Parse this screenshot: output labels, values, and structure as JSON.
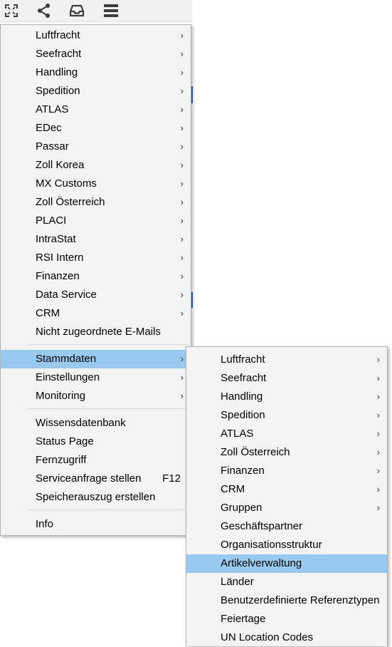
{
  "toolbar": {
    "icons": [
      "expand-icon",
      "share-icon",
      "inbox-icon",
      "hamburger-icon"
    ]
  },
  "main_menu": {
    "group1": [
      {
        "label": "Luftfracht",
        "submenu": true
      },
      {
        "label": "Seefracht",
        "submenu": true
      },
      {
        "label": "Handling",
        "submenu": true
      },
      {
        "label": "Spedition",
        "submenu": true
      },
      {
        "label": "ATLAS",
        "submenu": true
      },
      {
        "label": "EDec",
        "submenu": true
      },
      {
        "label": "Passar",
        "submenu": true
      },
      {
        "label": "Zoll Korea",
        "submenu": true
      },
      {
        "label": "MX Customs",
        "submenu": true
      },
      {
        "label": "Zoll Österreich",
        "submenu": true
      },
      {
        "label": "PLACI",
        "submenu": true
      },
      {
        "label": "IntraStat",
        "submenu": true
      },
      {
        "label": "RSI Intern",
        "submenu": true
      },
      {
        "label": "Finanzen",
        "submenu": true
      },
      {
        "label": "Data Service",
        "submenu": true
      },
      {
        "label": "CRM",
        "submenu": true
      },
      {
        "label": "Nicht zugeordnete E-Mails",
        "submenu": false
      }
    ],
    "group2": [
      {
        "label": "Stammdaten",
        "submenu": true,
        "active": true
      },
      {
        "label": "Einstellungen",
        "submenu": true
      },
      {
        "label": "Monitoring",
        "submenu": true
      }
    ],
    "group3": [
      {
        "label": "Wissensdatenbank"
      },
      {
        "label": "Status Page"
      },
      {
        "label": "Fernzugriff"
      },
      {
        "label": "Serviceanfrage stellen",
        "shortcut": "F12"
      },
      {
        "label": "Speicherauszug erstellen"
      }
    ],
    "group4": [
      {
        "label": "Info"
      }
    ]
  },
  "sub_menu": {
    "items": [
      {
        "label": "Luftfracht",
        "submenu": true
      },
      {
        "label": "Seefracht",
        "submenu": true
      },
      {
        "label": "Handling",
        "submenu": true
      },
      {
        "label": "Spedition",
        "submenu": true
      },
      {
        "label": "ATLAS",
        "submenu": true
      },
      {
        "label": "Zoll Österreich",
        "submenu": true
      },
      {
        "label": "Finanzen",
        "submenu": true
      },
      {
        "label": "CRM",
        "submenu": true
      },
      {
        "label": "Gruppen",
        "submenu": true
      },
      {
        "label": "Geschäftspartner",
        "submenu": false
      },
      {
        "label": "Organisationsstruktur",
        "submenu": false
      },
      {
        "label": "Artikelverwaltung",
        "submenu": false,
        "highlighted": true
      },
      {
        "label": "Länder",
        "submenu": false
      },
      {
        "label": "Benutzerdefinierte Referenztypen",
        "submenu": false
      },
      {
        "label": "Feiertage",
        "submenu": false
      },
      {
        "label": "UN Location Codes",
        "submenu": false
      }
    ]
  },
  "arrow_glyph": "›",
  "colors": {
    "highlight": "#99c9ef",
    "menu_bg": "#f3f3f3",
    "menu_border": "#b4b4b4",
    "toolbar_bg": "#f0f0f0",
    "icon": "#3c3c3c"
  }
}
